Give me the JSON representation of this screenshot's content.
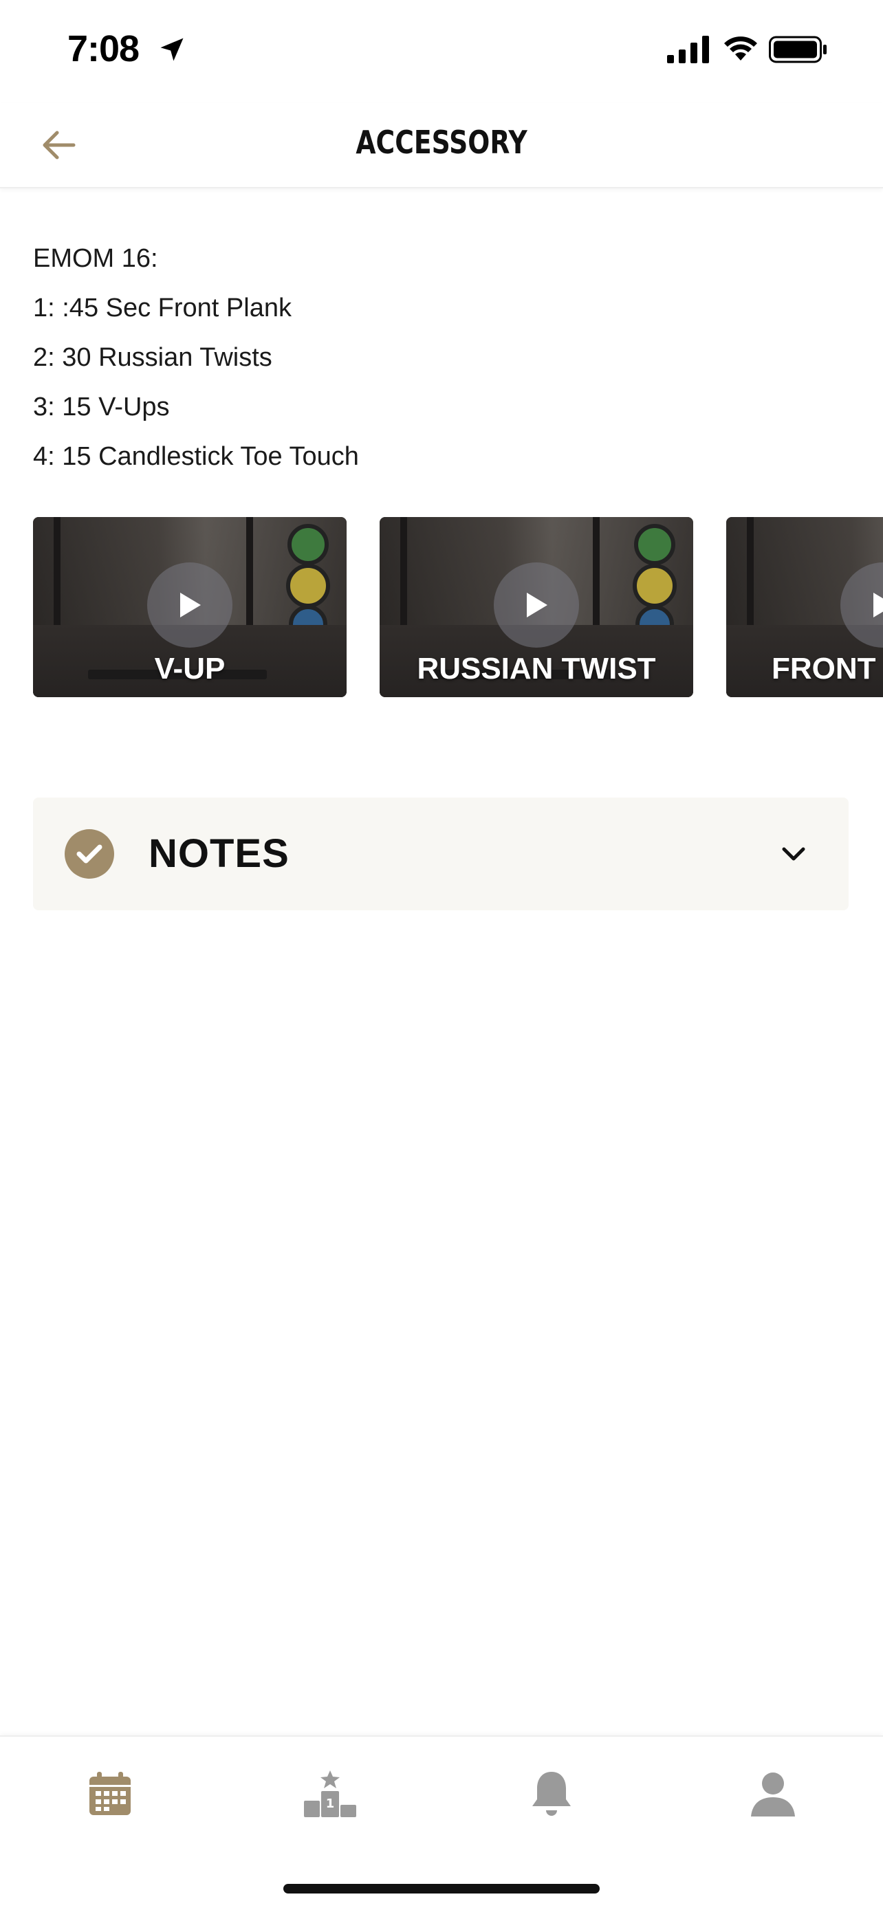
{
  "status_bar": {
    "time": "7:08"
  },
  "header": {
    "title": "ACCESSORY",
    "back_icon": "arrow-left-icon"
  },
  "workout": {
    "lines": [
      "EMOM 16:",
      "1: :45 Sec Front Plank",
      "2: 30 Russian Twists",
      "3: 15 V-Ups",
      "4: 15 Candlestick Toe Touch"
    ]
  },
  "videos": [
    {
      "label": "V-UP"
    },
    {
      "label": "RUSSIAN TWIST"
    },
    {
      "label": "FRONT"
    }
  ],
  "notes": {
    "title": "NOTES",
    "completed": true
  },
  "tab_bar": {
    "tabs": [
      {
        "name": "calendar",
        "icon": "calendar-icon",
        "active": true
      },
      {
        "name": "leaderboard",
        "icon": "podium-icon",
        "active": false
      },
      {
        "name": "notifications",
        "icon": "bell-icon",
        "active": false
      },
      {
        "name": "profile",
        "icon": "person-icon",
        "active": false
      }
    ]
  },
  "colors": {
    "accent": "#a08c6a",
    "inactive_icon": "#9a9a9a",
    "notes_bg": "#f8f7f3"
  }
}
